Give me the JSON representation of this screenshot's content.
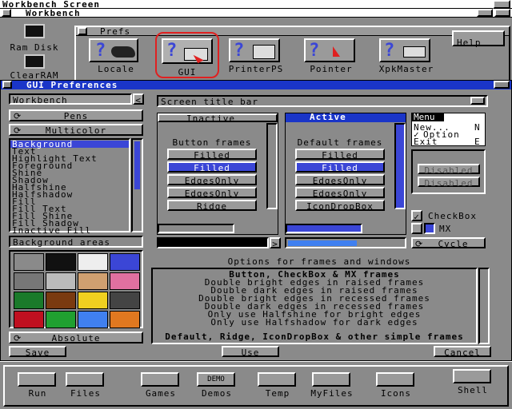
{
  "screen": {
    "title": "Workbench Screen"
  },
  "workbench_window": {
    "title": "Workbench"
  },
  "desktop_icons": [
    {
      "label": "Ram Disk"
    },
    {
      "label": "ClearRAM"
    }
  ],
  "prefs_window": {
    "title": "Prefs",
    "icons": [
      "Locale",
      "GUI",
      "PrinterPS",
      "Pointer",
      "XpkMaster"
    ],
    "help": "Help"
  },
  "gui_prefs": {
    "title": "GUI Preferences",
    "workbench_field": "Workbench",
    "pens_button": "Pens",
    "multicolor_button": "Multicolor",
    "pen_list": [
      "Background",
      "Text",
      "Highlight Text",
      "Foreground",
      "Shine",
      "Shadow",
      "Halfshine",
      "Halfshadow",
      "Fill",
      "Fill Text",
      "Fill Shine",
      "Fill Shadow",
      "Inactive Fill"
    ],
    "pen_selected": 0,
    "area_label": "Background areas",
    "palette": [
      "#8a8a8a",
      "#111111",
      "#eeeeee",
      "#3b46d6",
      "#777777",
      "#bbbbbb",
      "#d0a070",
      "#e070a0",
      "#1a7a2a",
      "#7a3a10",
      "#f0d020",
      "#444444",
      "#c01020",
      "#20a030",
      "#4080f0",
      "#e07820"
    ],
    "absolute_button": "Absolute",
    "save": "Save",
    "use": "Use",
    "cancel": "Cancel",
    "screen_select": "Screen title bar",
    "inactive_title": "Inactive",
    "active_title": "Active",
    "button_frames_label": "Button frames",
    "default_frames_label": "Default frames",
    "inactive_buttons": [
      "Filled",
      "Filled",
      "EdgesOnly",
      "EdgesOnly",
      "Ridge"
    ],
    "active_buttons": [
      "Filled",
      "Filled",
      "EdgesOnly",
      "EdgesOnly",
      "IconDropBox"
    ],
    "menu_title": "Menu",
    "menu_items": [
      {
        "label": "New...",
        "key": "N"
      },
      {
        "label": "Option",
        "check": "✓"
      },
      {
        "label": "Exit",
        "key": "E"
      }
    ],
    "disabled_labels": [
      "Disabled",
      "Disabled"
    ],
    "checkbox_label": "CheckBox",
    "mx_label": "MX",
    "cycle_label": "Cycle",
    "options_title": "Options for frames and windows",
    "info_lines": [
      "Button, CheckBox & MX frames",
      "Double bright edges in raised frames",
      "Double dark edges in raised frames",
      "Double bright edges in recessed frames",
      "Double dark edges in recessed frames",
      "Only use Halfshine for bright edges",
      "Only use Halfshadow for dark edges"
    ],
    "info_footer": "Default, Ridge, IconDropBox & other simple frames"
  },
  "dock": [
    {
      "label": "Run"
    },
    {
      "label": "Files"
    },
    {
      "label": "Games"
    },
    {
      "label": "Demos"
    },
    {
      "label": "Temp"
    },
    {
      "label": "MyFiles"
    },
    {
      "label": "Icons"
    },
    {
      "label": "Shell"
    }
  ],
  "dock_demo_text": "DEMO",
  "colors": {
    "accent": "#1a35c8",
    "highlight": "#3b46d6",
    "selection_ring": "#e02020",
    "background": "#8a8a8a"
  }
}
